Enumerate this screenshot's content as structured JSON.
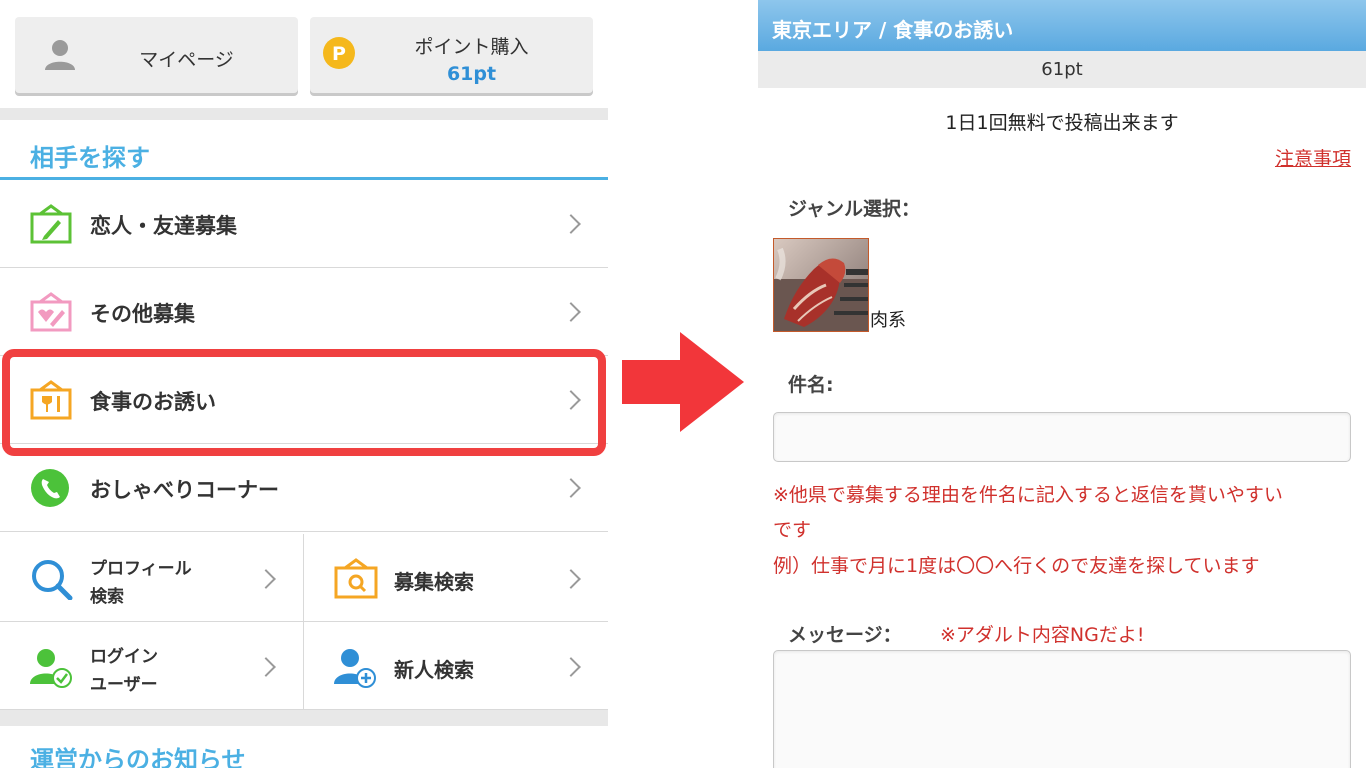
{
  "left": {
    "top_buttons": {
      "mypage_label": "マイページ",
      "point_label": "ポイント購入",
      "point_value": "61pt"
    },
    "section_find": "相手を探す",
    "menu": [
      {
        "label": "恋人・友達募集"
      },
      {
        "label": "その他募集"
      },
      {
        "label": "食事のお誘い"
      },
      {
        "label": "おしゃべりコーナー"
      }
    ],
    "grid": {
      "profile_search_l1": "プロフィール",
      "profile_search_l2": "検索",
      "recruit_search": "募集検索",
      "login_users_l1": "ログイン",
      "login_users_l2": "ユーザー",
      "newcomer_search": "新人検索"
    },
    "section_news": "運営からのお知らせ"
  },
  "right": {
    "header_title": "東京エリア / 食事のお誘い",
    "points": "61pt",
    "free_notice": "1日1回無料で投稿出来ます",
    "caution_link": "注意事項",
    "genre_label": "ジャンル選択：",
    "genre_value": "肉系",
    "subject_label": "件名:",
    "subject_value": "",
    "note_line1": "※他県で募集する理由を件名に記入すると返信を貰いやすい",
    "note_line2": "です",
    "note_line3": "例）仕事で月に1度は〇〇へ行くので友達を探しています",
    "message_label": "メッセージ：",
    "adult_warning": "※アダルト内容NGだよ!",
    "message_value": ""
  },
  "colors": {
    "accent_blue": "#4bb0e3",
    "highlight_red": "#f04040",
    "warning_red": "#d0312d",
    "point_blue": "#2f8fd6"
  }
}
